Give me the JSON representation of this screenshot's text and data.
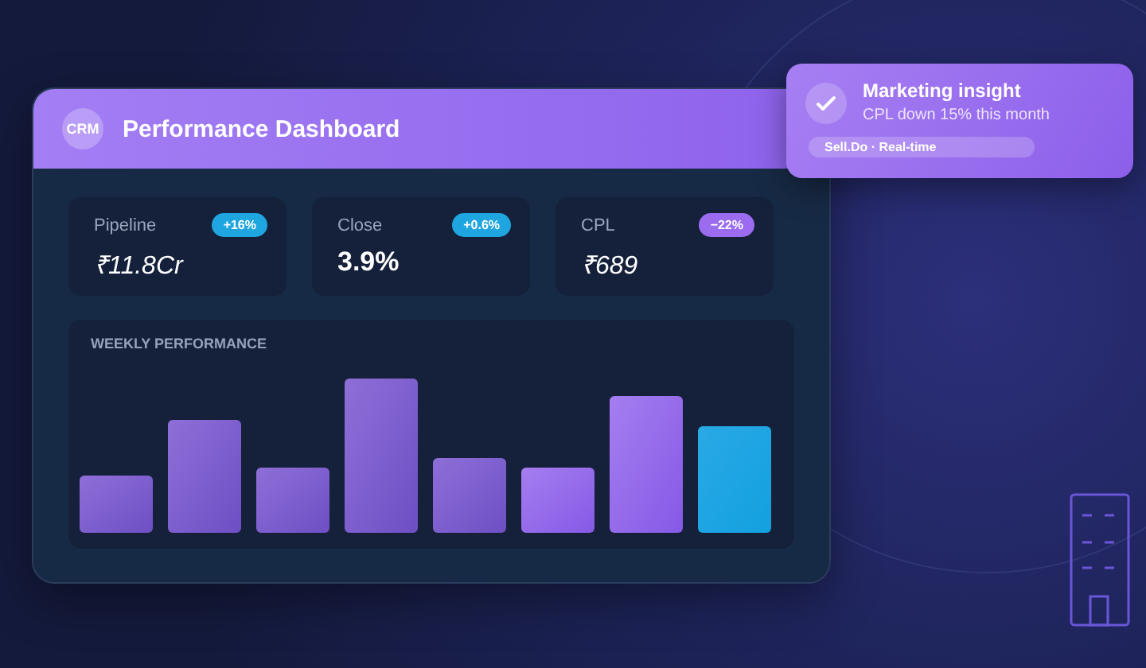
{
  "dashboard": {
    "logo": "CRM",
    "title": "Performance Dashboard",
    "metrics": [
      {
        "label": "Pipeline",
        "value": "₹11.8Cr",
        "badge": "+16%",
        "color": "#1fa6e0",
        "kind": "plain"
      },
      {
        "label": "Close",
        "value": "3.9%",
        "badge": "+0.6%",
        "color": "#1fa6e0",
        "kind": "strong"
      },
      {
        "label": "CPL",
        "value": "₹689",
        "badge": "−22%",
        "color": "#9b6bf0",
        "kind": "plain"
      }
    ],
    "chart": {
      "title": "WEEKLY PERFORMANCE"
    }
  },
  "notification": {
    "title": "Marketing insight",
    "message": "CPL down 15% this month",
    "tag": "Sell.Do · Real-time"
  }
}
